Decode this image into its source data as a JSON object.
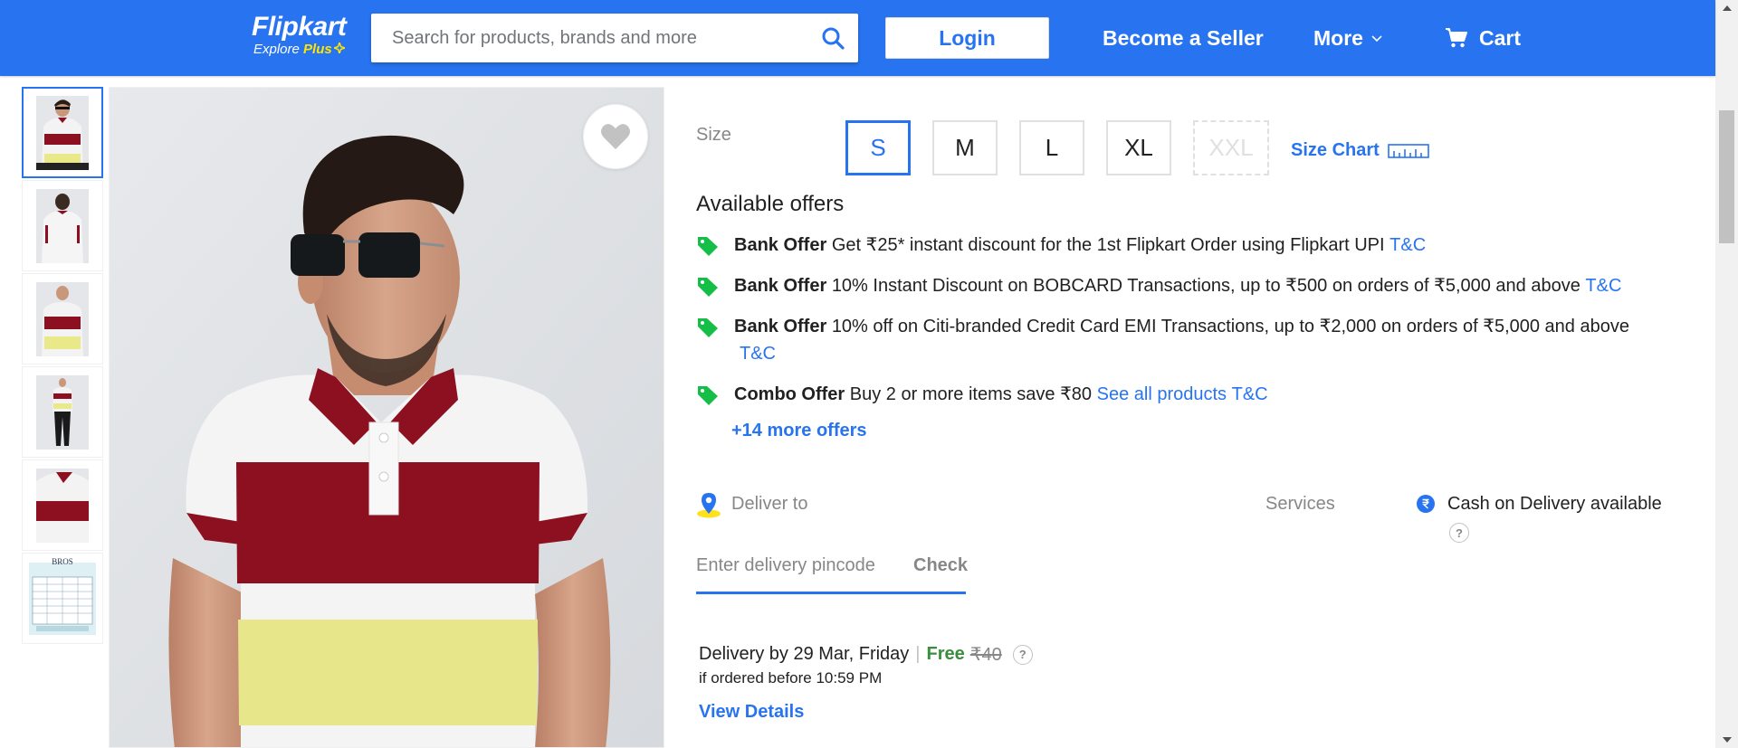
{
  "header": {
    "logo": "Flipkart",
    "tagline": "Explore",
    "plus": "Plus",
    "search_placeholder": "Search for products, brands and more",
    "login": "Login",
    "become_seller": "Become a Seller",
    "more": "More",
    "cart": "Cart",
    "brand_color": "#2874f0"
  },
  "gallery": {
    "thumbnail_count": 6,
    "selected_index": 0,
    "size_chart_thumb_title": "BROS"
  },
  "sizes": {
    "label": "Size",
    "options": [
      {
        "label": "S",
        "state": "selected"
      },
      {
        "label": "M",
        "state": "available"
      },
      {
        "label": "L",
        "state": "available"
      },
      {
        "label": "XL",
        "state": "available"
      },
      {
        "label": "XXL",
        "state": "unavailable"
      }
    ],
    "size_chart": "Size Chart"
  },
  "offers": {
    "title": "Available offers",
    "items": [
      {
        "type": "Bank Offer",
        "text": "Get ₹25* instant discount for the 1st Flipkart Order using Flipkart UPI",
        "extra": "",
        "tnc": "T&C"
      },
      {
        "type": "Bank Offer",
        "text": "10% Instant Discount on BOBCARD Transactions, up to ₹500 on orders of ₹5,000 and above",
        "extra": "",
        "tnc": "T&C"
      },
      {
        "type": "Bank Offer",
        "text": "10% off on Citi-branded Credit Card EMI Transactions, up to ₹2,000 on orders of ₹5,000 and above",
        "extra": "",
        "tnc": "T&C"
      },
      {
        "type": "Combo Offer",
        "text": "Buy 2 or more items save ₹80",
        "extra": "See all products",
        "tnc": "T&C"
      }
    ],
    "more": "+14 more offers"
  },
  "delivery": {
    "deliver_to": "Deliver to",
    "pincode_placeholder": "Enter delivery pincode",
    "check": "Check",
    "date": "Delivery by 29 Mar, Friday",
    "separator": "|",
    "free": "Free",
    "original_fee": "₹40",
    "cutoff": "if ordered before 10:59 PM",
    "view_details": "View Details"
  },
  "services": {
    "label": "Services",
    "cod": "Cash on Delivery available"
  },
  "icons": {
    "help": "?"
  }
}
